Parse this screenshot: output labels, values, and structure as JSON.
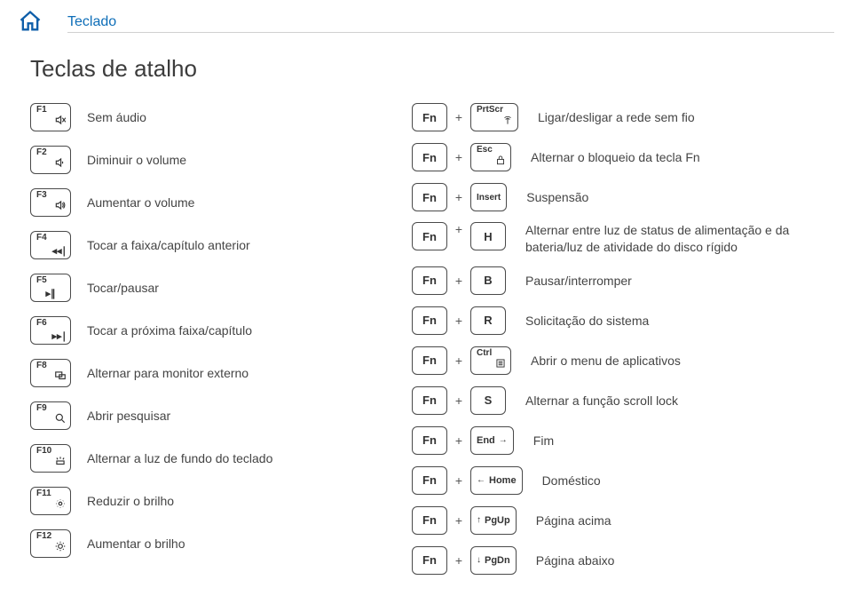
{
  "breadcrumb": "Teclado",
  "title": "Teclas de atalho",
  "plus_sign": "+",
  "left": {
    "r0": {
      "key": "F1",
      "desc": "Sem áudio"
    },
    "r1": {
      "key": "F2",
      "desc": "Diminuir o volume"
    },
    "r2": {
      "key": "F3",
      "desc": "Aumentar o volume"
    },
    "r3": {
      "key": "F4",
      "desc": "Tocar a faixa/capítulo anterior"
    },
    "r4": {
      "key": "F5",
      "desc": "Tocar/pausar"
    },
    "r5": {
      "key": "F6",
      "desc": "Tocar a próxima faixa/capítulo"
    },
    "r6": {
      "key": "F8",
      "desc": "Alternar para monitor externo"
    },
    "r7": {
      "key": "F9",
      "desc": "Abrir pesquisar"
    },
    "r8": {
      "key": "F10",
      "desc": "Alternar a luz de fundo do teclado"
    },
    "r9": {
      "key": "F11",
      "desc": "Reduzir o brilho"
    },
    "r10": {
      "key": "F12",
      "desc": "Aumentar o brilho"
    }
  },
  "right": {
    "r0": {
      "k1": "Fn",
      "k2": "PrtScr",
      "desc": "Ligar/desligar a rede sem fio"
    },
    "r1": {
      "k1": "Fn",
      "k2": "Esc",
      "desc": "Alternar o bloqueio da tecla Fn"
    },
    "r2": {
      "k1": "Fn",
      "k2": "Insert",
      "desc": "Suspensão"
    },
    "r3": {
      "k1": "Fn",
      "k2": "H",
      "desc": "Alternar entre luz de status de alimentação e da bateria/luz de atividade do disco rígido"
    },
    "r4": {
      "k1": "Fn",
      "k2": "B",
      "desc": "Pausar/interromper"
    },
    "r5": {
      "k1": "Fn",
      "k2": "R",
      "desc": "Solicitação do sistema"
    },
    "r6": {
      "k1": "Fn",
      "k2": "Ctrl",
      "desc": "Abrir o menu de aplicativos"
    },
    "r7": {
      "k1": "Fn",
      "k2": "S",
      "desc": "Alternar a função scroll lock"
    },
    "r8": {
      "k1": "Fn",
      "k2": "End",
      "desc": "Fim"
    },
    "r9": {
      "k1": "Fn",
      "k2": "Home",
      "desc": "Doméstico"
    },
    "r10": {
      "k1": "Fn",
      "k2": "PgUp",
      "desc": "Página acima"
    },
    "r11": {
      "k1": "Fn",
      "k2": "PgDn",
      "desc": "Página abaixo"
    }
  }
}
